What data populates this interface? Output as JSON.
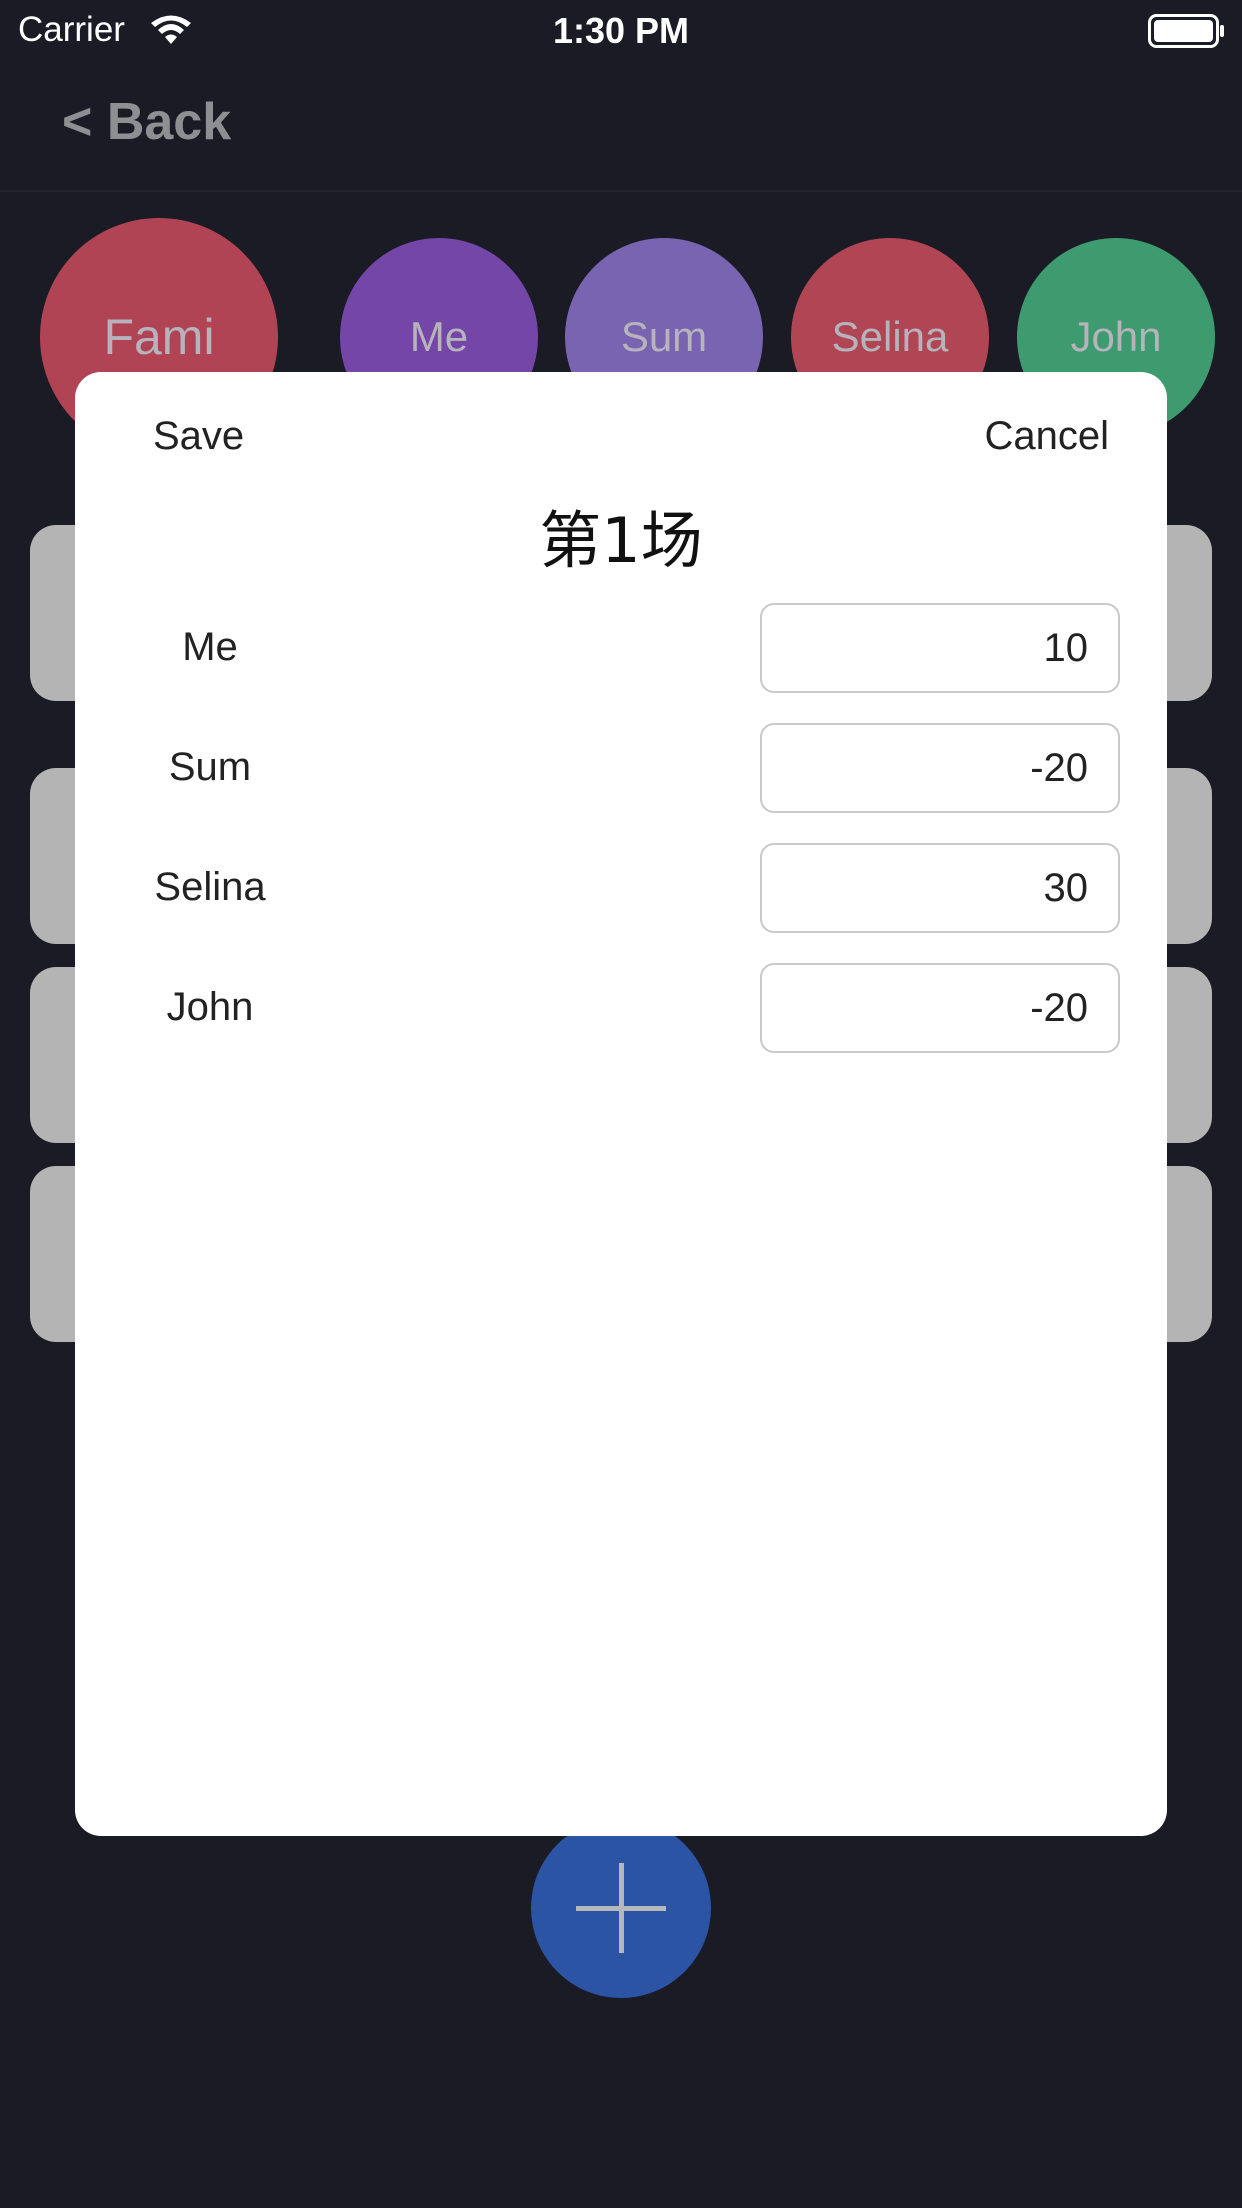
{
  "status_bar": {
    "carrier": "Carrier",
    "time": "1:30 PM",
    "wifi_icon": "wifi-icon",
    "battery_icon": "battery-icon"
  },
  "nav": {
    "back_label": "< Back"
  },
  "players": [
    {
      "name": "Fami",
      "color": "#b14454"
    },
    {
      "name": "Me",
      "color": "#7446a8"
    },
    {
      "name": "Sum",
      "color": "#7964b1"
    },
    {
      "name": "Selina",
      "color": "#b04654"
    },
    {
      "name": "John",
      "color": "#3d9b6f"
    }
  ],
  "modal": {
    "save_label": "Save",
    "cancel_label": "Cancel",
    "title": "第1场",
    "rows": [
      {
        "name": "Me",
        "value": "10"
      },
      {
        "name": "Sum",
        "value": "-20"
      },
      {
        "name": "Selina",
        "value": "30"
      },
      {
        "name": "John",
        "value": "-20"
      }
    ]
  },
  "add_button": {
    "icon": "plus-icon",
    "color": "#2c54a4"
  },
  "colors": {
    "background": "#1a1b24",
    "card": "#b4b4b4",
    "modal": "#ffffff"
  }
}
